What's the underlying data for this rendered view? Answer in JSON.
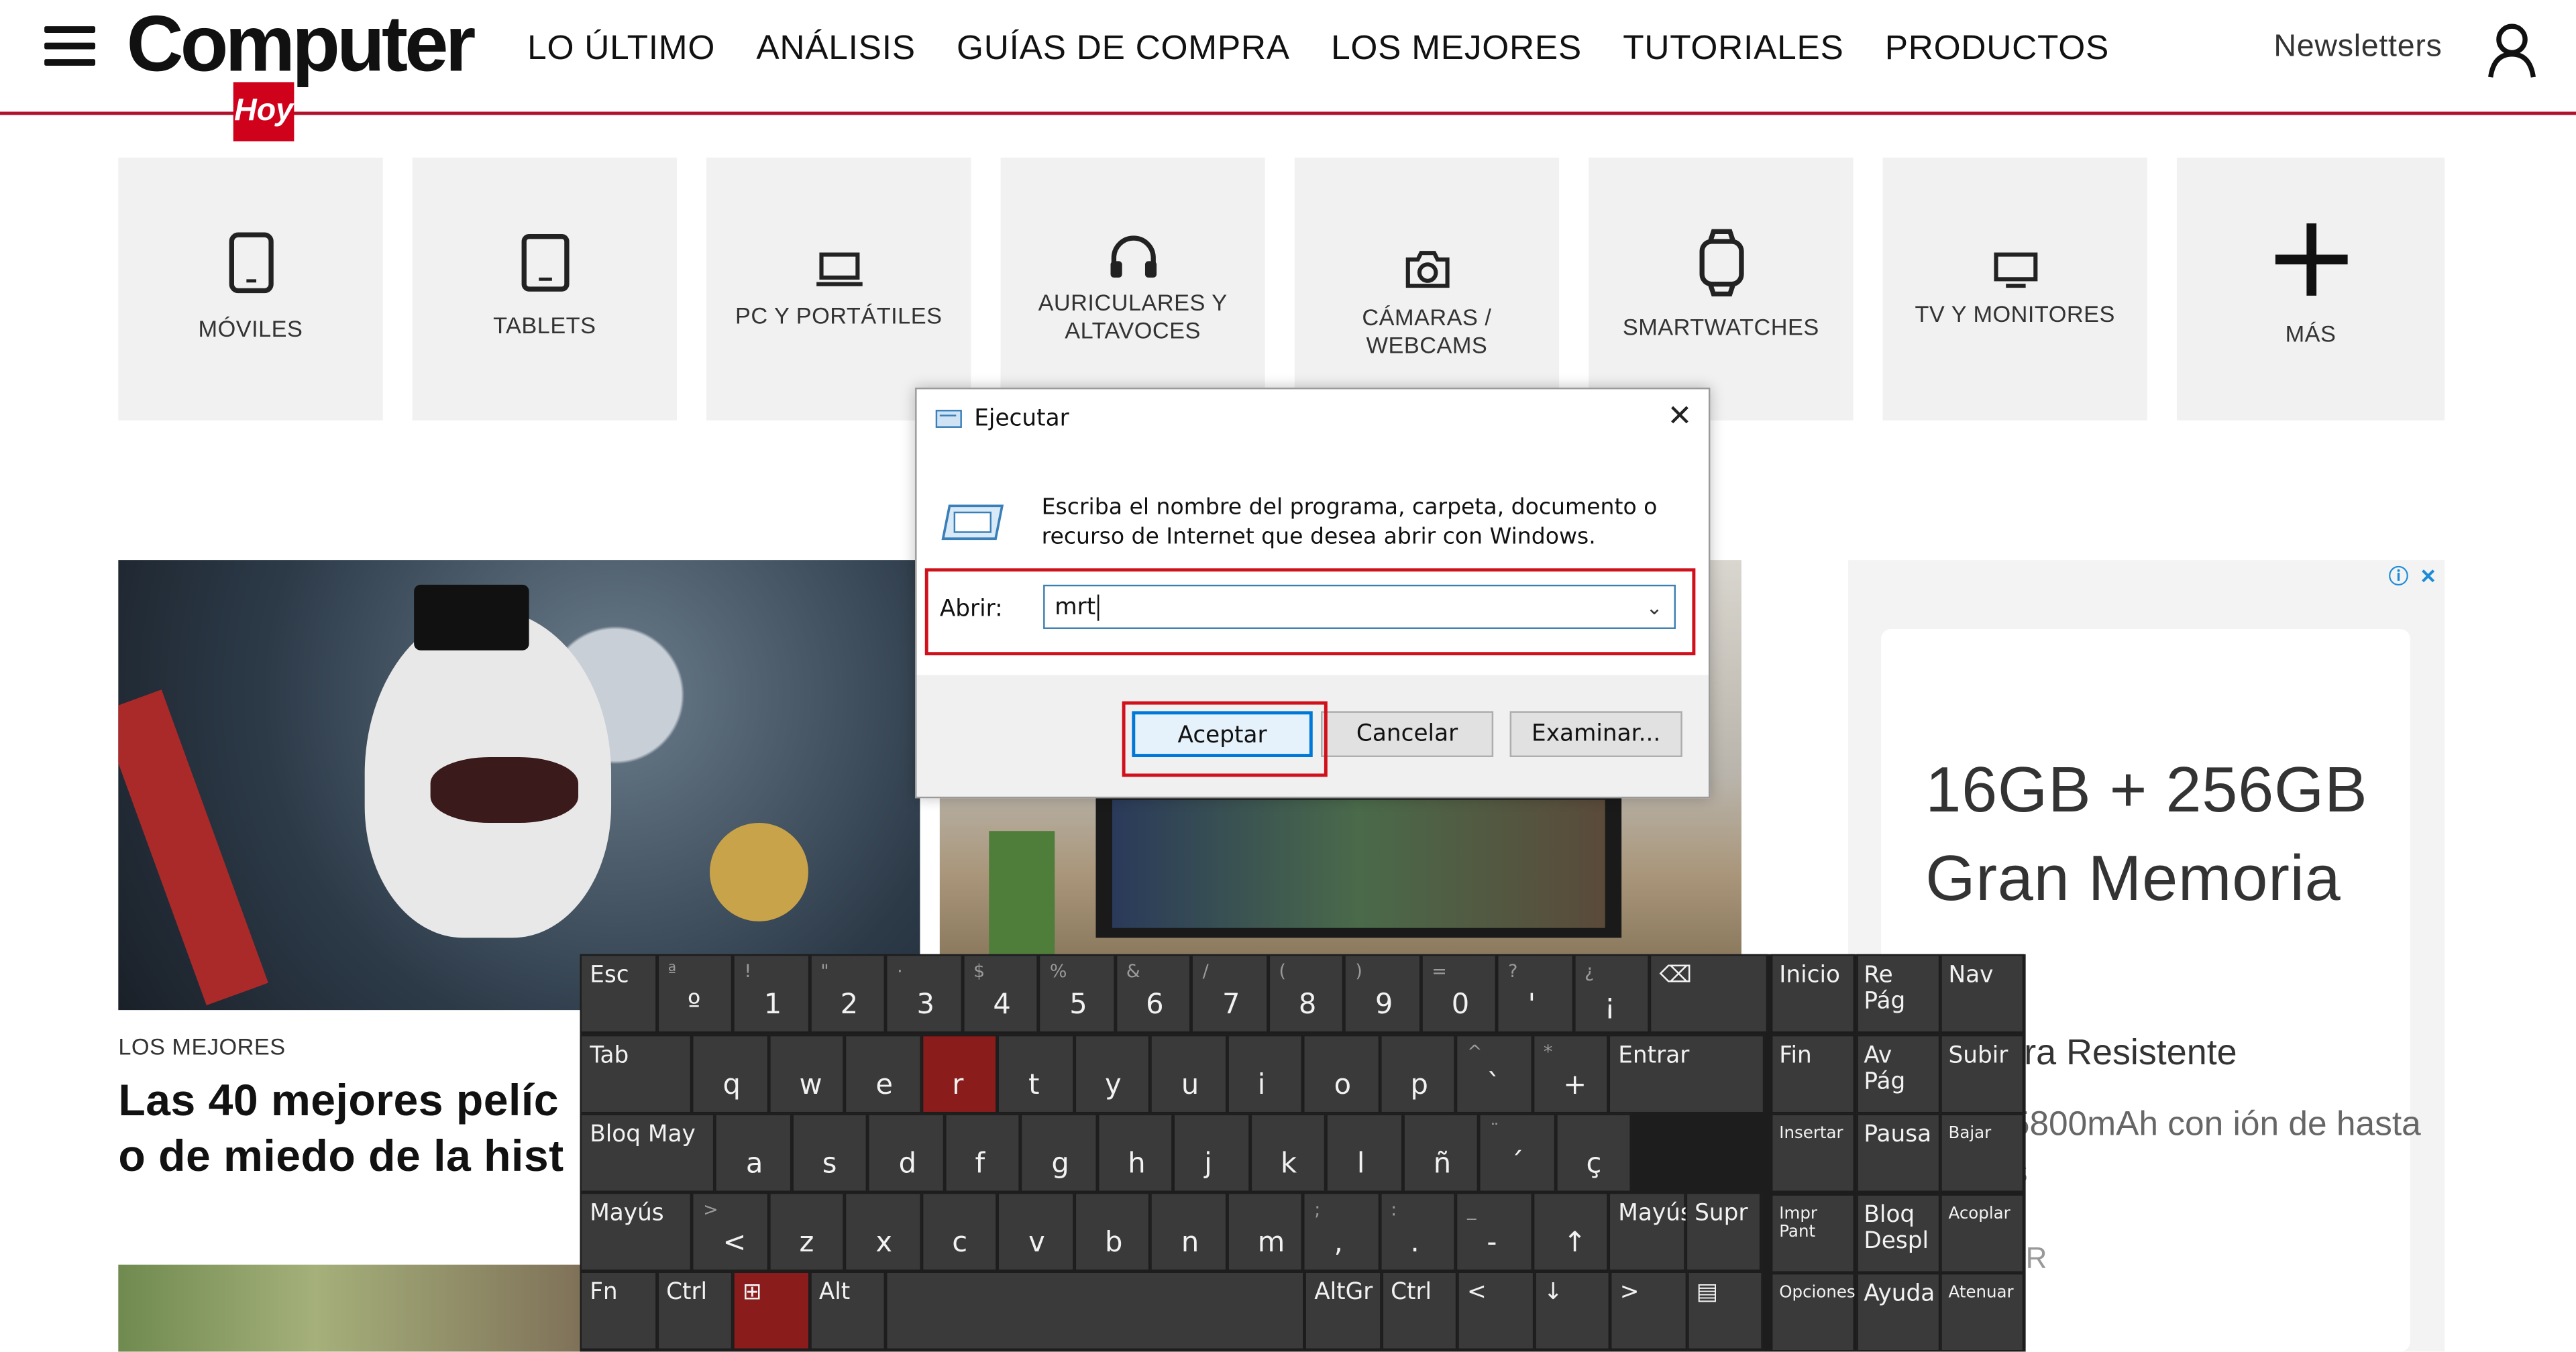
{
  "header": {
    "logo_text": "Computer",
    "logo_sub": "Hoy",
    "nav": [
      "LO ÚLTIMO",
      "ANÁLISIS",
      "GUÍAS DE COMPRA",
      "LOS MEJORES",
      "TUTORIALES",
      "PRODUCTOS"
    ],
    "newsletters": "Newsletters"
  },
  "categories": [
    {
      "label": "MÓVILES",
      "icon": "mobile-icon"
    },
    {
      "label": "TABLETS",
      "icon": "tablet-icon"
    },
    {
      "label": "PC Y PORTÁTILES",
      "icon": "laptop-icon"
    },
    {
      "label": "AURICULARES Y ALTAVOCES",
      "icon": "headphones-icon"
    },
    {
      "label": "CÁMARAS / WEBCAMS",
      "icon": "camera-icon"
    },
    {
      "label": "SMARTWATCHES",
      "icon": "smartwatch-icon"
    },
    {
      "label": "TV Y MONITORES",
      "icon": "monitor-icon"
    },
    {
      "label": "MÁS",
      "icon": "plus-icon"
    }
  ],
  "article": {
    "kicker": "LOS MEJORES",
    "headline_line1": "Las 40 mejores pelíc",
    "headline_line2": "o de miedo de la hist"
  },
  "ad": {
    "title": "16GB + 256GB Gran Memoria",
    "sub": "lla Ultra Resistente",
    "desc": "a de 5800mAh con ión de hasta 3 días",
    "r": "R"
  },
  "dialog": {
    "title": "Ejecutar",
    "text": "Escriba el nombre del programa, carpeta, documento o recurso de Internet que desea abrir con Windows.",
    "abrir_label": "Abrir:",
    "input_value": "mrt",
    "btn_ok": "Aceptar",
    "btn_cancel": "Cancelar",
    "btn_browse": "Examinar..."
  },
  "keyboard": {
    "row1": [
      {
        "m": "Esc"
      },
      {
        "m": "º",
        "s": "ª"
      },
      {
        "m": "1",
        "s": "!"
      },
      {
        "m": "2",
        "s": "\""
      },
      {
        "m": "3",
        "s": "·"
      },
      {
        "m": "4",
        "s": "$"
      },
      {
        "m": "5",
        "s": "%"
      },
      {
        "m": "6",
        "s": "&"
      },
      {
        "m": "7",
        "s": "/"
      },
      {
        "m": "8",
        "s": "("
      },
      {
        "m": "9",
        "s": ")"
      },
      {
        "m": "0",
        "s": "="
      },
      {
        "m": "'",
        "s": "?"
      },
      {
        "m": "¡",
        "s": "¿"
      },
      {
        "m": "⌫"
      }
    ],
    "row2": [
      {
        "m": "Tab"
      },
      {
        "m": "q"
      },
      {
        "m": "w"
      },
      {
        "m": "e"
      },
      {
        "m": "r"
      },
      {
        "m": "t"
      },
      {
        "m": "y"
      },
      {
        "m": "u"
      },
      {
        "m": "i"
      },
      {
        "m": "o"
      },
      {
        "m": "p"
      },
      {
        "m": "`",
        "s": "^"
      },
      {
        "m": "+",
        "s": "*"
      },
      {
        "m": "Entrar"
      }
    ],
    "row3": [
      {
        "m": "Bloq May"
      },
      {
        "m": "a"
      },
      {
        "m": "s"
      },
      {
        "m": "d"
      },
      {
        "m": "f"
      },
      {
        "m": "g"
      },
      {
        "m": "h"
      },
      {
        "m": "j"
      },
      {
        "m": "k"
      },
      {
        "m": "l"
      },
      {
        "m": "ñ"
      },
      {
        "m": "´",
        "s": "¨"
      },
      {
        "m": "ç"
      }
    ],
    "row4": [
      {
        "m": "Mayús"
      },
      {
        "m": "<",
        "s": ">"
      },
      {
        "m": "z"
      },
      {
        "m": "x"
      },
      {
        "m": "c"
      },
      {
        "m": "v"
      },
      {
        "m": "b"
      },
      {
        "m": "n"
      },
      {
        "m": "m"
      },
      {
        "m": ",",
        "s": ";"
      },
      {
        "m": ".",
        "s": ":"
      },
      {
        "m": "-",
        "s": "_"
      },
      {
        "m": "↑"
      },
      {
        "m": "Mayús"
      },
      {
        "m": "Supr"
      }
    ],
    "row5": [
      {
        "m": "Fn"
      },
      {
        "m": "Ctrl"
      },
      {
        "m": "⊞"
      },
      {
        "m": "Alt"
      },
      {
        "m": ""
      },
      {
        "m": "AltGr"
      },
      {
        "m": "Ctrl"
      },
      {
        "m": "<"
      },
      {
        "m": "↓"
      },
      {
        "m": ">"
      },
      {
        "m": "▤"
      }
    ],
    "nav": [
      [
        "Inicio",
        "Re Pág",
        "Nav"
      ],
      [
        "Fin",
        "Av Pág",
        "Subir"
      ],
      [
        "Insertar",
        "Pausa",
        "Bajar"
      ],
      [
        "Impr Pant",
        "Bloq Despl",
        "Acoplar"
      ],
      [
        "Opciones",
        "Ayuda",
        "Atenuar"
      ]
    ]
  },
  "colors": {
    "accent": "#d0021b",
    "key": "#3a3a3a",
    "key_active": "#8b1c1c"
  }
}
